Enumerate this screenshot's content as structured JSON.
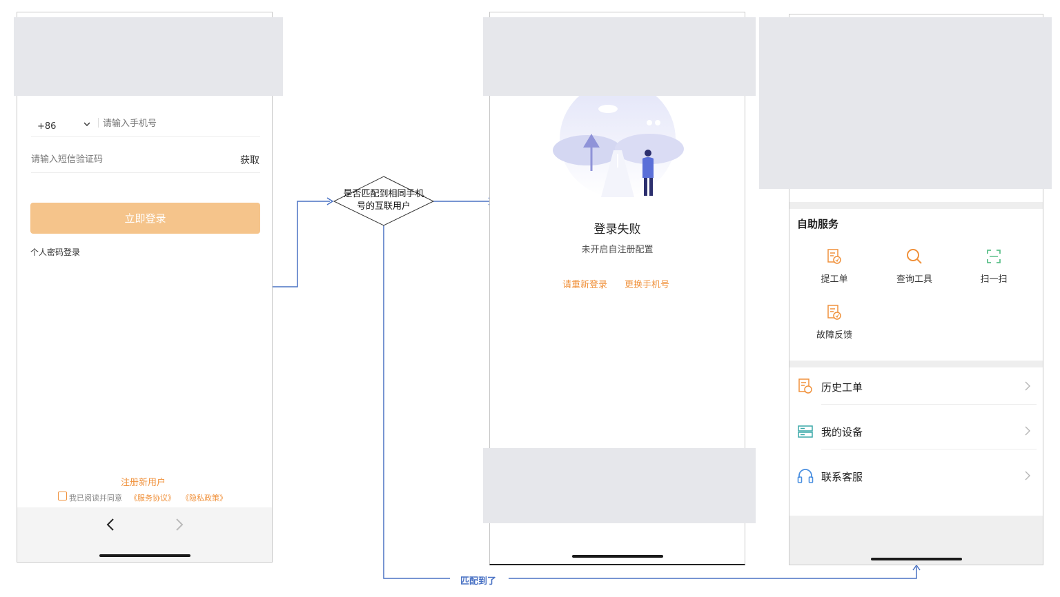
{
  "login_screen": {
    "country_code": "+86",
    "phone_placeholder": "请输入手机号",
    "sms_placeholder": "请输入短信验证码",
    "get_code_label": "获取",
    "login_button": "立即登录",
    "password_login_link": "个人密码登录",
    "register_link": "注册新用户",
    "agreement_prefix": "我已阅读并同意",
    "service_agreement": "《服务协议》",
    "privacy_policy": "《隐私政策》"
  },
  "flow": {
    "decision_line1": "是否匹配到相同手机",
    "decision_line2": "号的互联用户",
    "matched_label": "匹配到了"
  },
  "failure_screen": {
    "title": "登录失败",
    "subtitle": "未开启自注册配置",
    "retry_link": "请重新登录",
    "change_phone_link": "更换手机号"
  },
  "home_screen": {
    "section_title": "自助服务",
    "grid_items": [
      {
        "label": "提工单",
        "icon": "ticket-icon"
      },
      {
        "label": "查询工具",
        "icon": "search-icon"
      },
      {
        "label": "扫一扫",
        "icon": "scan-icon"
      },
      {
        "label": "故障反馈",
        "icon": "ticket-icon"
      }
    ],
    "menu_items": [
      {
        "label": "历史工单",
        "icon": "ticket-icon"
      },
      {
        "label": "我的设备",
        "icon": "device-icon"
      },
      {
        "label": "联系客服",
        "icon": "headset-icon"
      }
    ]
  },
  "colors": {
    "accent_orange": "#f0913b",
    "button_disabled": "#f5c48b",
    "connector_blue": "#4a72c4",
    "scan_green": "#5cc08a",
    "device_teal": "#3aa8a8",
    "headset_blue": "#4a8fe0"
  }
}
